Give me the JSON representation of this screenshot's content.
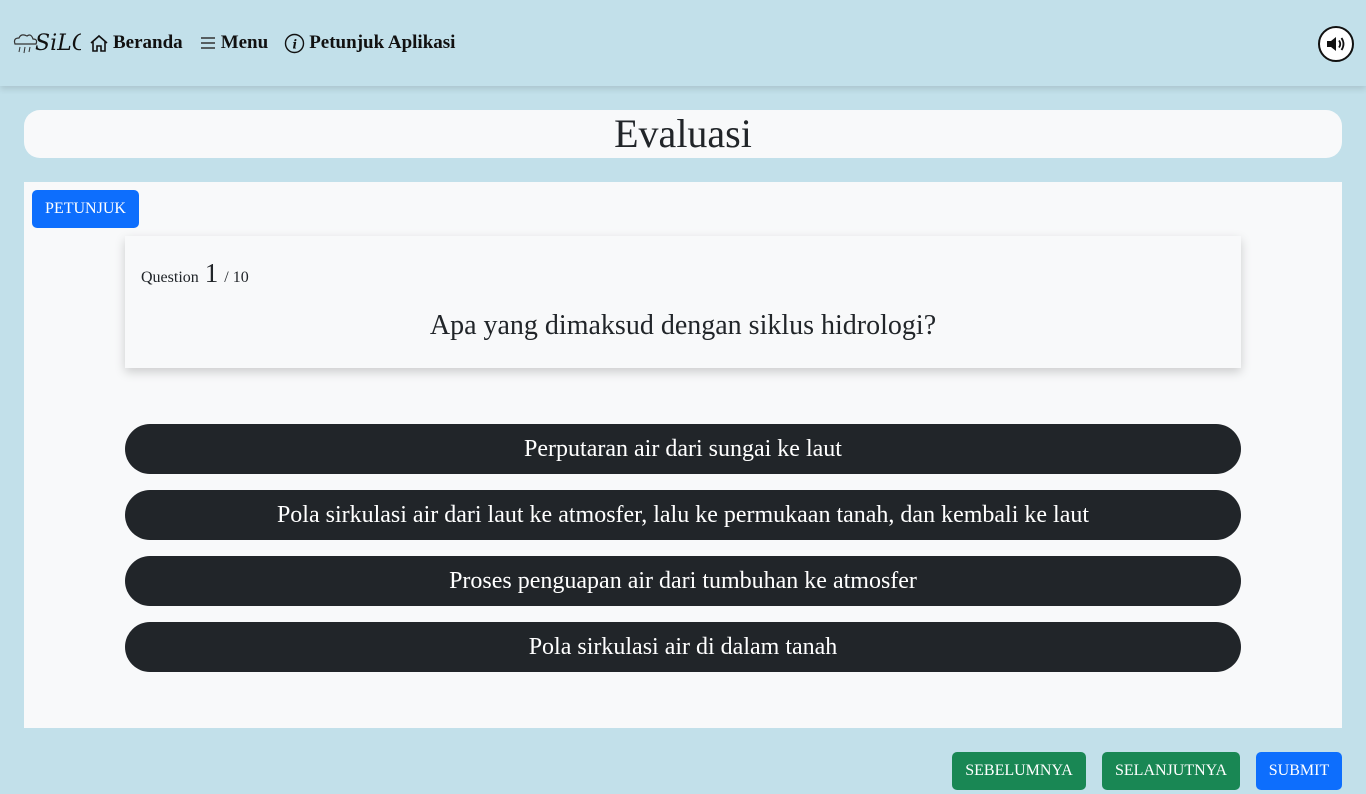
{
  "header": {
    "logo_text": "SiLO",
    "nav": [
      {
        "label": "Beranda",
        "icon": "home-icon"
      },
      {
        "label": "Menu",
        "icon": "hamburger-icon"
      },
      {
        "label": "Petunjuk Aplikasi",
        "icon": "info-circle-icon"
      }
    ],
    "sound_icon": "speaker-icon"
  },
  "page": {
    "title": "Evaluasi"
  },
  "panel": {
    "petunjuk_label": "PETUNJUK",
    "question_label": "Question",
    "question_number": "1",
    "question_total": "/ 10",
    "question_text": "Apa yang dimaksud dengan siklus hidrologi?",
    "answers": [
      "Perputaran air dari sungai ke laut",
      "Pola sirkulasi air dari laut ke atmosfer, lalu ke permukaan tanah, dan kembali ke laut",
      "Proses penguapan air dari tumbuhan ke atmosfer",
      "Pola sirkulasi air di dalam tanah"
    ]
  },
  "footer": {
    "prev_label": "SEBELUMNYA",
    "next_label": "SELANJUTNYA",
    "submit_label": "SUBMIT"
  },
  "colors": {
    "background": "#c2e0ea",
    "panel": "#f8f9fa",
    "answer_bg": "#212529",
    "primary": "#0d6efd",
    "success": "#198754"
  }
}
